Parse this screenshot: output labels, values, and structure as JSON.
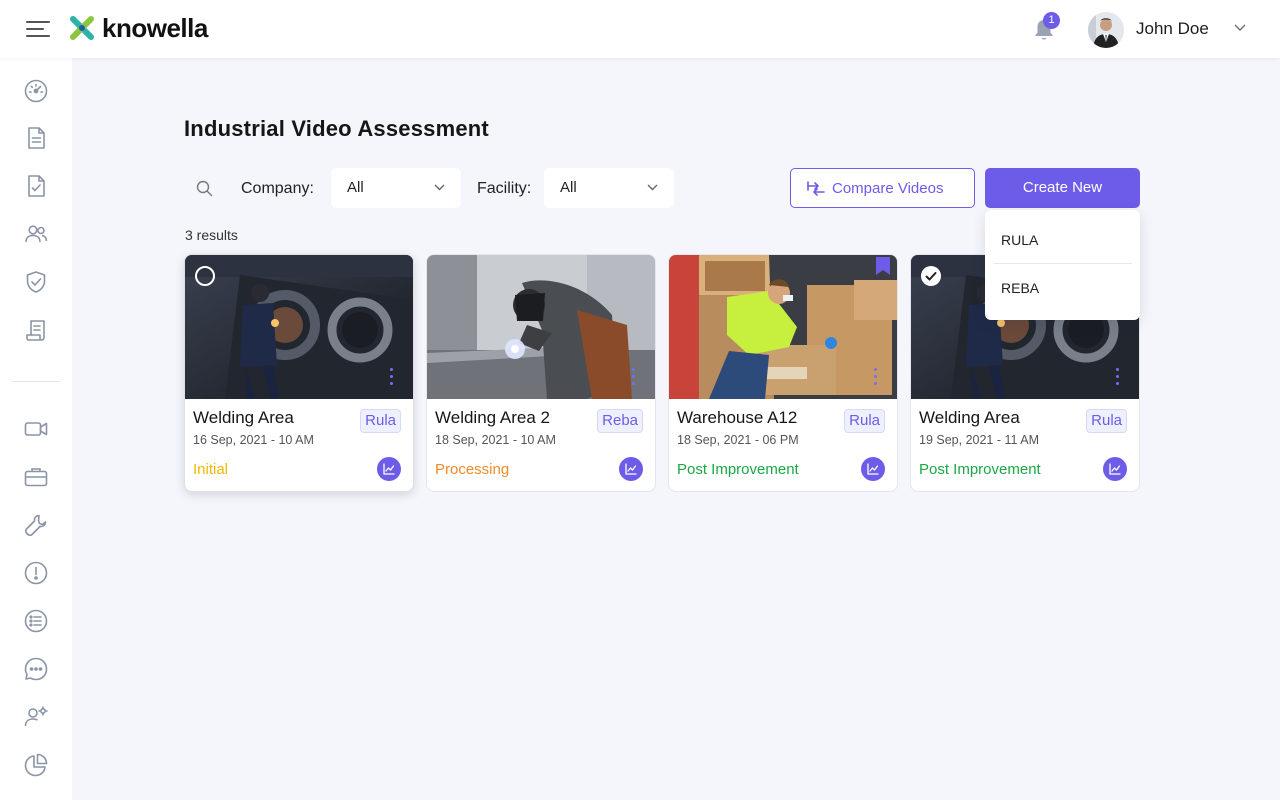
{
  "app": {
    "brand": "knowella",
    "notification_count": "1",
    "user_name": "John Doe"
  },
  "page": {
    "title": "Industrial Video Assessment",
    "results": "3 results"
  },
  "filters": {
    "company_label": "Company:",
    "company_value": "All",
    "facility_label": "Facility:",
    "facility_value": "All"
  },
  "actions": {
    "compare_label": "Compare Videos",
    "create_label": "Create New",
    "create_options": [
      "RULA",
      "REBA"
    ]
  },
  "cards": [
    {
      "title": "Welding Area",
      "date": "16 Sep, 2021 - 10 AM",
      "tag": "Rula",
      "status": "Initial",
      "status_color": "#f2b705"
    },
    {
      "title": "Welding Area 2",
      "date": "18 Sep, 2021 - 10 AM",
      "tag": "Reba",
      "status": "Processing",
      "status_color": "#f08a24"
    },
    {
      "title": "Warehouse A12",
      "date": "18 Sep, 2021 - 06 PM",
      "tag": "Rula",
      "status": "Post Improvement",
      "status_color": "#1aa844"
    },
    {
      "title": "Welding Area",
      "date": "19 Sep, 2021 - 11 AM",
      "tag": "Rula",
      "status": "Post Improvement",
      "status_color": "#1aa844"
    }
  ],
  "colors": {
    "accent": "#6c5ce7",
    "background": "#f4f6fb"
  },
  "icons": {
    "sidebar": [
      "dashboard-icon",
      "document-icon",
      "checklist-icon",
      "users-icon",
      "shield-check-icon",
      "report-icon",
      "video-icon",
      "briefcase-icon",
      "wrench-icon",
      "alert-icon",
      "list-icon",
      "chat-icon",
      "user-settings-icon",
      "pie-chart-icon"
    ]
  }
}
